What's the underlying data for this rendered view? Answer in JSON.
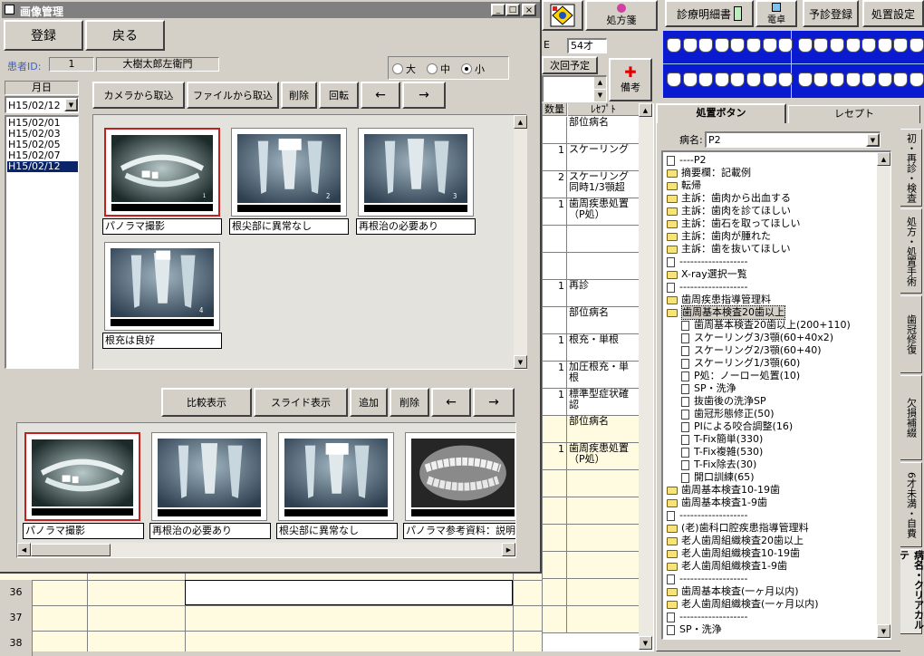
{
  "window": {
    "title": "画像管理",
    "login_label": "登録",
    "back_label": "戻る",
    "patient_id_label": "患者ID:",
    "patient_id_value": "1",
    "patient_name": "大樹太郎左衛門",
    "size_options": [
      "大",
      "中",
      "小"
    ],
    "size_selected": "小",
    "date_label": "月日",
    "date_selected": "H15/02/12",
    "dates": [
      "H15/02/01",
      "H15/02/03",
      "H15/02/05",
      "H15/02/07",
      "H15/02/12"
    ],
    "toolbar1": {
      "camera": "カメラから取込",
      "file": "ファイルから取込",
      "delete": "削除",
      "rotate": "回転",
      "prev": "←",
      "next": "→"
    },
    "images": [
      {
        "caption": "パノラマ撮影",
        "kind": "panorama",
        "number": "1",
        "selected": true
      },
      {
        "caption": "根尖部に異常なし",
        "kind": "periapical-a",
        "number": "2",
        "selected": false
      },
      {
        "caption": "再根治の必要あり",
        "kind": "periapical-b",
        "number": "3",
        "selected": false
      },
      {
        "caption": "根充は良好",
        "kind": "periapical-c",
        "number": "4",
        "selected": false
      }
    ],
    "toolbar2": {
      "compare": "比較表示",
      "slide": "スライド表示",
      "add": "追加",
      "delete": "削除",
      "prev": "←",
      "next": "→"
    },
    "strip": [
      {
        "caption": "パノラマ撮影",
        "kind": "panorama",
        "selected": true
      },
      {
        "caption": "再根治の必要あり",
        "kind": "periapical-b",
        "selected": false
      },
      {
        "caption": "根尖部に異常なし",
        "kind": "periapical-a",
        "selected": false
      },
      {
        "caption": "パノラマ参考資料：説明用",
        "kind": "intraoral",
        "selected": false
      }
    ]
  },
  "grid_rows": [
    "36",
    "37",
    "38"
  ],
  "top_right": {
    "prescription": "処方箋",
    "statement": "診療明細書",
    "denpyo": "電卓",
    "reserve": "予診登録",
    "settings": "処置設定",
    "age_prefix": "E",
    "age": "54才",
    "next_appt": "次回予定",
    "memo": "備考"
  },
  "middle_col": {
    "header_qty": "数量",
    "header_receipt": "ﾚｾﾌﾟﾄ",
    "rows": [
      {
        "q": "",
        "r": "部位病名",
        "h": 30,
        "yellow": false
      },
      {
        "q": "1",
        "r": "スケーリング",
        "h": 30,
        "yellow": false
      },
      {
        "q": "2",
        "r": "スケーリング同時1/3顎超",
        "h": 30,
        "yellow": false
      },
      {
        "q": "1",
        "r": "歯周疾患処置（P処）",
        "h": 30,
        "yellow": false
      },
      {
        "q": "",
        "r": "",
        "h": 30,
        "yellow": false
      },
      {
        "q": "",
        "r": "",
        "h": 30,
        "yellow": false
      },
      {
        "q": "1",
        "r": "再診",
        "h": 30,
        "yellow": false
      },
      {
        "q": "",
        "r": "部位病名",
        "h": 30,
        "yellow": false
      },
      {
        "q": "1",
        "r": "根充・単根",
        "h": 30,
        "yellow": false
      },
      {
        "q": "1",
        "r": "加圧根充・単根",
        "h": 30,
        "yellow": false
      },
      {
        "q": "1",
        "r": "標準型症状確認",
        "h": 30,
        "yellow": false
      },
      {
        "q": "",
        "r": "部位病名",
        "h": 30,
        "yellow": true
      },
      {
        "q": "1",
        "r": "歯周疾患処置（P処）",
        "h": 30,
        "yellow": true
      },
      {
        "q": "",
        "r": "",
        "h": 30,
        "yellow": true
      },
      {
        "q": "",
        "r": "",
        "h": 30,
        "yellow": true
      },
      {
        "q": "",
        "r": "",
        "h": 30,
        "yellow": true
      },
      {
        "q": "",
        "r": "",
        "h": 30,
        "yellow": true
      },
      {
        "q": "",
        "r": "",
        "h": 30,
        "yellow": true
      },
      {
        "q": "",
        "r": "",
        "h": 30,
        "yellow": true
      }
    ]
  },
  "right_panel": {
    "tab_buttons": "処置ボタン",
    "tab_receipt": "レセプト",
    "disease_label": "病名:",
    "disease_value": "P2",
    "side_tabs": [
      "初・再診・検査",
      "処方・処置手術",
      "歯冠修復",
      "欠損補綴",
      "6才未満・自費",
      "病名・クリアカルテ"
    ],
    "tree": [
      {
        "t": "----P2",
        "icon": "doc",
        "indent": 0
      },
      {
        "t": "摘要欄：記載例",
        "icon": "folder",
        "indent": 0
      },
      {
        "t": "転帰",
        "icon": "folder",
        "indent": 0
      },
      {
        "t": "主訴：歯肉から出血する",
        "icon": "folder",
        "indent": 0
      },
      {
        "t": "主訴：歯肉を診てほしい",
        "icon": "folder",
        "indent": 0
      },
      {
        "t": "主訴：歯石を取ってほしい",
        "icon": "folder",
        "indent": 0
      },
      {
        "t": "主訴：歯肉が腫れた",
        "icon": "folder",
        "indent": 0
      },
      {
        "t": "主訴：歯を抜いてほしい",
        "icon": "folder",
        "indent": 0
      },
      {
        "t": "-------------------",
        "icon": "doc",
        "indent": 0
      },
      {
        "t": "X-ray選択一覧",
        "icon": "folder",
        "indent": 0
      },
      {
        "t": "-------------------",
        "icon": "doc",
        "indent": 0
      },
      {
        "t": "歯周疾患指導管理料",
        "icon": "folder",
        "indent": 0
      },
      {
        "t": "歯周基本検査20歯以上",
        "icon": "folder",
        "indent": 0,
        "hl": true
      },
      {
        "t": "歯周基本検査20歯以上(200+110)",
        "icon": "doc",
        "indent": 1
      },
      {
        "t": "スケーリング3/3顎(60+40x2)",
        "icon": "doc",
        "indent": 1
      },
      {
        "t": "スケーリング2/3顎(60+40)",
        "icon": "doc",
        "indent": 1
      },
      {
        "t": "スケーリング1/3顎(60)",
        "icon": "doc",
        "indent": 1
      },
      {
        "t": "P処：ノーロー処置(10)",
        "icon": "doc",
        "indent": 1
      },
      {
        "t": "SP・洗浄",
        "icon": "doc",
        "indent": 1
      },
      {
        "t": "抜歯後の洗浄SP",
        "icon": "doc",
        "indent": 1
      },
      {
        "t": "歯冠形態修正(50)",
        "icon": "doc",
        "indent": 1
      },
      {
        "t": "PIによる咬合調整(16)",
        "icon": "doc",
        "indent": 1
      },
      {
        "t": "T-Fix簡単(330)",
        "icon": "doc",
        "indent": 1
      },
      {
        "t": "T-Fix複雑(530)",
        "icon": "doc",
        "indent": 1
      },
      {
        "t": "T-Fix除去(30)",
        "icon": "doc",
        "indent": 1
      },
      {
        "t": "開口訓練(65)",
        "icon": "doc",
        "indent": 1
      },
      {
        "t": "歯周基本検査10-19歯",
        "icon": "folder",
        "indent": 0
      },
      {
        "t": "歯周基本検査1-9歯",
        "icon": "folder",
        "indent": 0
      },
      {
        "t": "-------------------",
        "icon": "doc",
        "indent": 0
      },
      {
        "t": "(老)歯科口腔疾患指導管理料",
        "icon": "folder",
        "indent": 0
      },
      {
        "t": "老人歯周組織検査20歯以上",
        "icon": "folder",
        "indent": 0
      },
      {
        "t": "老人歯周組織検査10-19歯",
        "icon": "folder",
        "indent": 0
      },
      {
        "t": "老人歯周組織検査1-9歯",
        "icon": "folder",
        "indent": 0
      },
      {
        "t": "-------------------",
        "icon": "doc",
        "indent": 0
      },
      {
        "t": "歯周基本検査(一ヶ月以内)",
        "icon": "folder",
        "indent": 0
      },
      {
        "t": "老人歯周組織検査(一ヶ月以内)",
        "icon": "folder",
        "indent": 0
      },
      {
        "t": "-------------------",
        "icon": "doc",
        "indent": 0
      },
      {
        "t": "SP・洗浄",
        "icon": "doc",
        "indent": 0
      }
    ]
  },
  "colors": {
    "face": "#d4d0c8",
    "title_bar": "#808080",
    "selection": "#0a246a",
    "yellow_row": "#fffbe0"
  }
}
